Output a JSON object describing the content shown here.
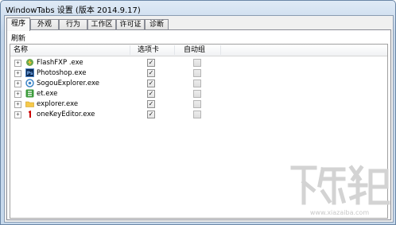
{
  "window": {
    "title": "WindowTabs 设置 (版本 2014.9.17)"
  },
  "tabs": [
    {
      "label": "程序",
      "active": true
    },
    {
      "label": "外观",
      "active": false
    },
    {
      "label": "行为",
      "active": false
    },
    {
      "label": "工作区",
      "active": false
    },
    {
      "label": "许可证",
      "active": false
    },
    {
      "label": "诊断",
      "active": false
    }
  ],
  "toolbar": {
    "refresh_label": "刷新"
  },
  "columns": {
    "name": "名称",
    "tab": "选项卡",
    "group": "自动组"
  },
  "apps": [
    {
      "name": "FlashFXP .exe",
      "icon": "flashfxp-icon",
      "tab_checked": true,
      "group_checked": false
    },
    {
      "name": "Photoshop.exe",
      "icon": "photoshop-icon",
      "tab_checked": true,
      "group_checked": false
    },
    {
      "name": "SogouExplorer.exe",
      "icon": "sogou-explorer-icon",
      "tab_checked": true,
      "group_checked": false
    },
    {
      "name": "et.exe",
      "icon": "wps-spreadsheet-icon",
      "tab_checked": true,
      "group_checked": false
    },
    {
      "name": "explorer.exe",
      "icon": "folder-icon",
      "tab_checked": true,
      "group_checked": false
    },
    {
      "name": "oneKeyEditor.exe",
      "icon": "onekey-editor-icon",
      "tab_checked": true,
      "group_checked": false
    }
  ],
  "watermark": {
    "text": "www.xiazaiba.com"
  },
  "colors": {
    "title_bar": "#c4d6ea",
    "border": "#6b87a6",
    "accent": "#2b579a"
  }
}
